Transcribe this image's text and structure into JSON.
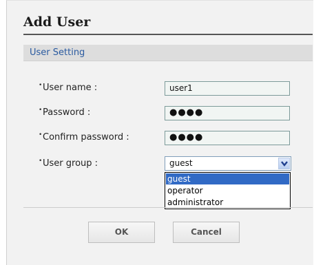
{
  "dialog": {
    "title": "Add User",
    "section_title": "User Setting"
  },
  "form": {
    "bullet": "•",
    "username": {
      "label": "User name :",
      "value": "user1"
    },
    "password": {
      "label": "Password :",
      "value": "●●●●"
    },
    "confirm": {
      "label": "Confirm password :",
      "value": "●●●●"
    },
    "group": {
      "label": "User group :",
      "selected": "guest",
      "options": [
        "guest",
        "operator",
        "administrator"
      ],
      "highlighted_option": "guest"
    }
  },
  "buttons": {
    "ok": "OK",
    "cancel": "Cancel"
  },
  "colors": {
    "section_text": "#2a5aa0",
    "highlight": "#316ac5"
  },
  "icons": {
    "select_arrow": "chevron-down-icon"
  }
}
